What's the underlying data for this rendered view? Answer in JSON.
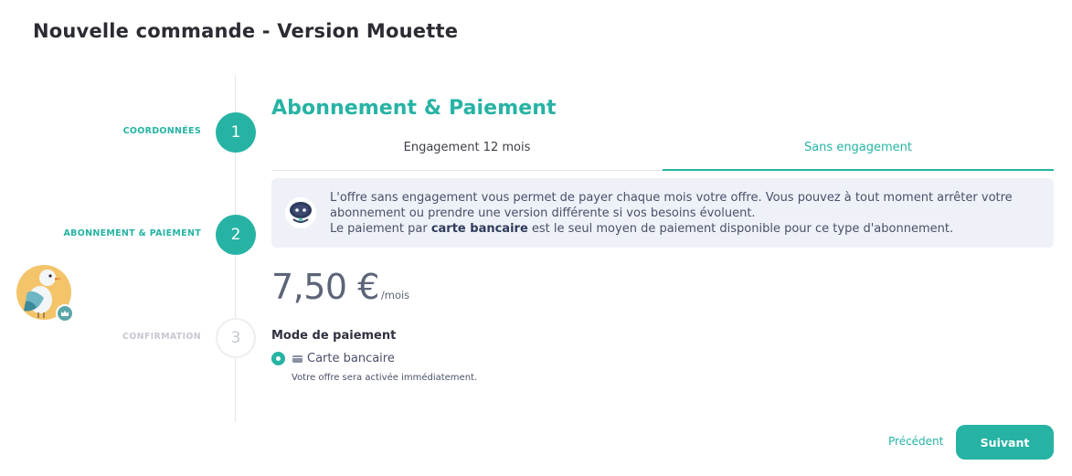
{
  "page": {
    "title": "Nouvelle commande - Version Mouette"
  },
  "steps": [
    {
      "number": "1",
      "label": "COORDONNÉES",
      "state": "done"
    },
    {
      "number": "2",
      "label": "ABONNEMENT & PAIEMENT",
      "state": "active"
    },
    {
      "number": "3",
      "label": "CONFIRMATION",
      "state": "pending"
    }
  ],
  "mascot": {
    "icon": "seagull-avatar-icon",
    "badge_icon": "crown-icon"
  },
  "section": {
    "title": "Abonnement & Paiement"
  },
  "tabs": [
    {
      "label": "Engagement 12 mois",
      "active": false
    },
    {
      "label": "Sans engagement",
      "active": true
    }
  ],
  "info": {
    "icon": "robot-icon",
    "line1": "L'offre sans engagement vous permet de payer chaque mois votre offre. Vous pouvez à tout moment arrêter votre abonnement ou prendre une version différente si vos besoins évoluent.",
    "line2_before": "Le paiement par ",
    "line2_bold": "carte bancaire",
    "line2_after": " est le seul moyen de paiement disponible pour ce type d'abonnement."
  },
  "price": {
    "value": "7,50 €",
    "unit": "/mois"
  },
  "payment": {
    "label": "Mode de paiement",
    "option_label": "Carte bancaire",
    "option_icon": "credit-card-icon",
    "selected": true,
    "hint": "Votre offre sera activée immédiatement."
  },
  "actions": {
    "previous_label": "Précédent",
    "next_label": "Suivant"
  },
  "colors": {
    "accent": "#26b3a4",
    "info_bg": "#eef1f8",
    "muted": "#c5c9cf"
  }
}
